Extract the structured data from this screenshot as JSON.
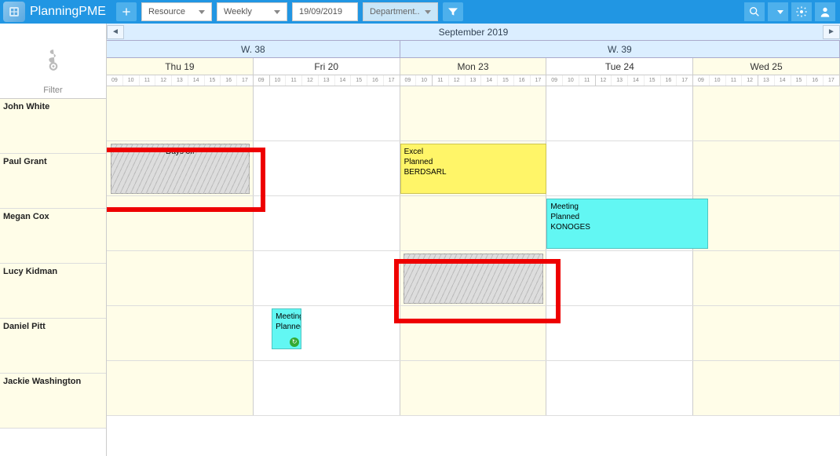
{
  "app": {
    "brand": "PlanningPME"
  },
  "toolbar": {
    "resource": "Resource",
    "weekly": "Weekly",
    "date": "19/09/2019",
    "department": "Department.."
  },
  "month": {
    "label": "September 2019"
  },
  "weeks": [
    "W. 38",
    "W. 39"
  ],
  "days": [
    "Thu 19",
    "Fri 20",
    "Mon 23",
    "Tue 24",
    "Wed 25"
  ],
  "hours": [
    "09",
    "10",
    "11",
    "12",
    "13",
    "14",
    "15",
    "16",
    "17"
  ],
  "filter": {
    "label": "Filter"
  },
  "resources": [
    "John White",
    "Paul Grant",
    "Megan Cox",
    "Lucy Kidman",
    "Daniel Pitt",
    "Jackie Washington"
  ],
  "events": {
    "paul_daysoff": "Days off",
    "paul_excel_l1": "Excel",
    "paul_excel_l2": "Planned",
    "paul_excel_l3": "BERDSARL",
    "megan_l1": "Meeting",
    "megan_l2": "Planned",
    "megan_l3": "KONOGES",
    "daniel_l1": "Meeting",
    "daniel_l2": "Planned"
  }
}
